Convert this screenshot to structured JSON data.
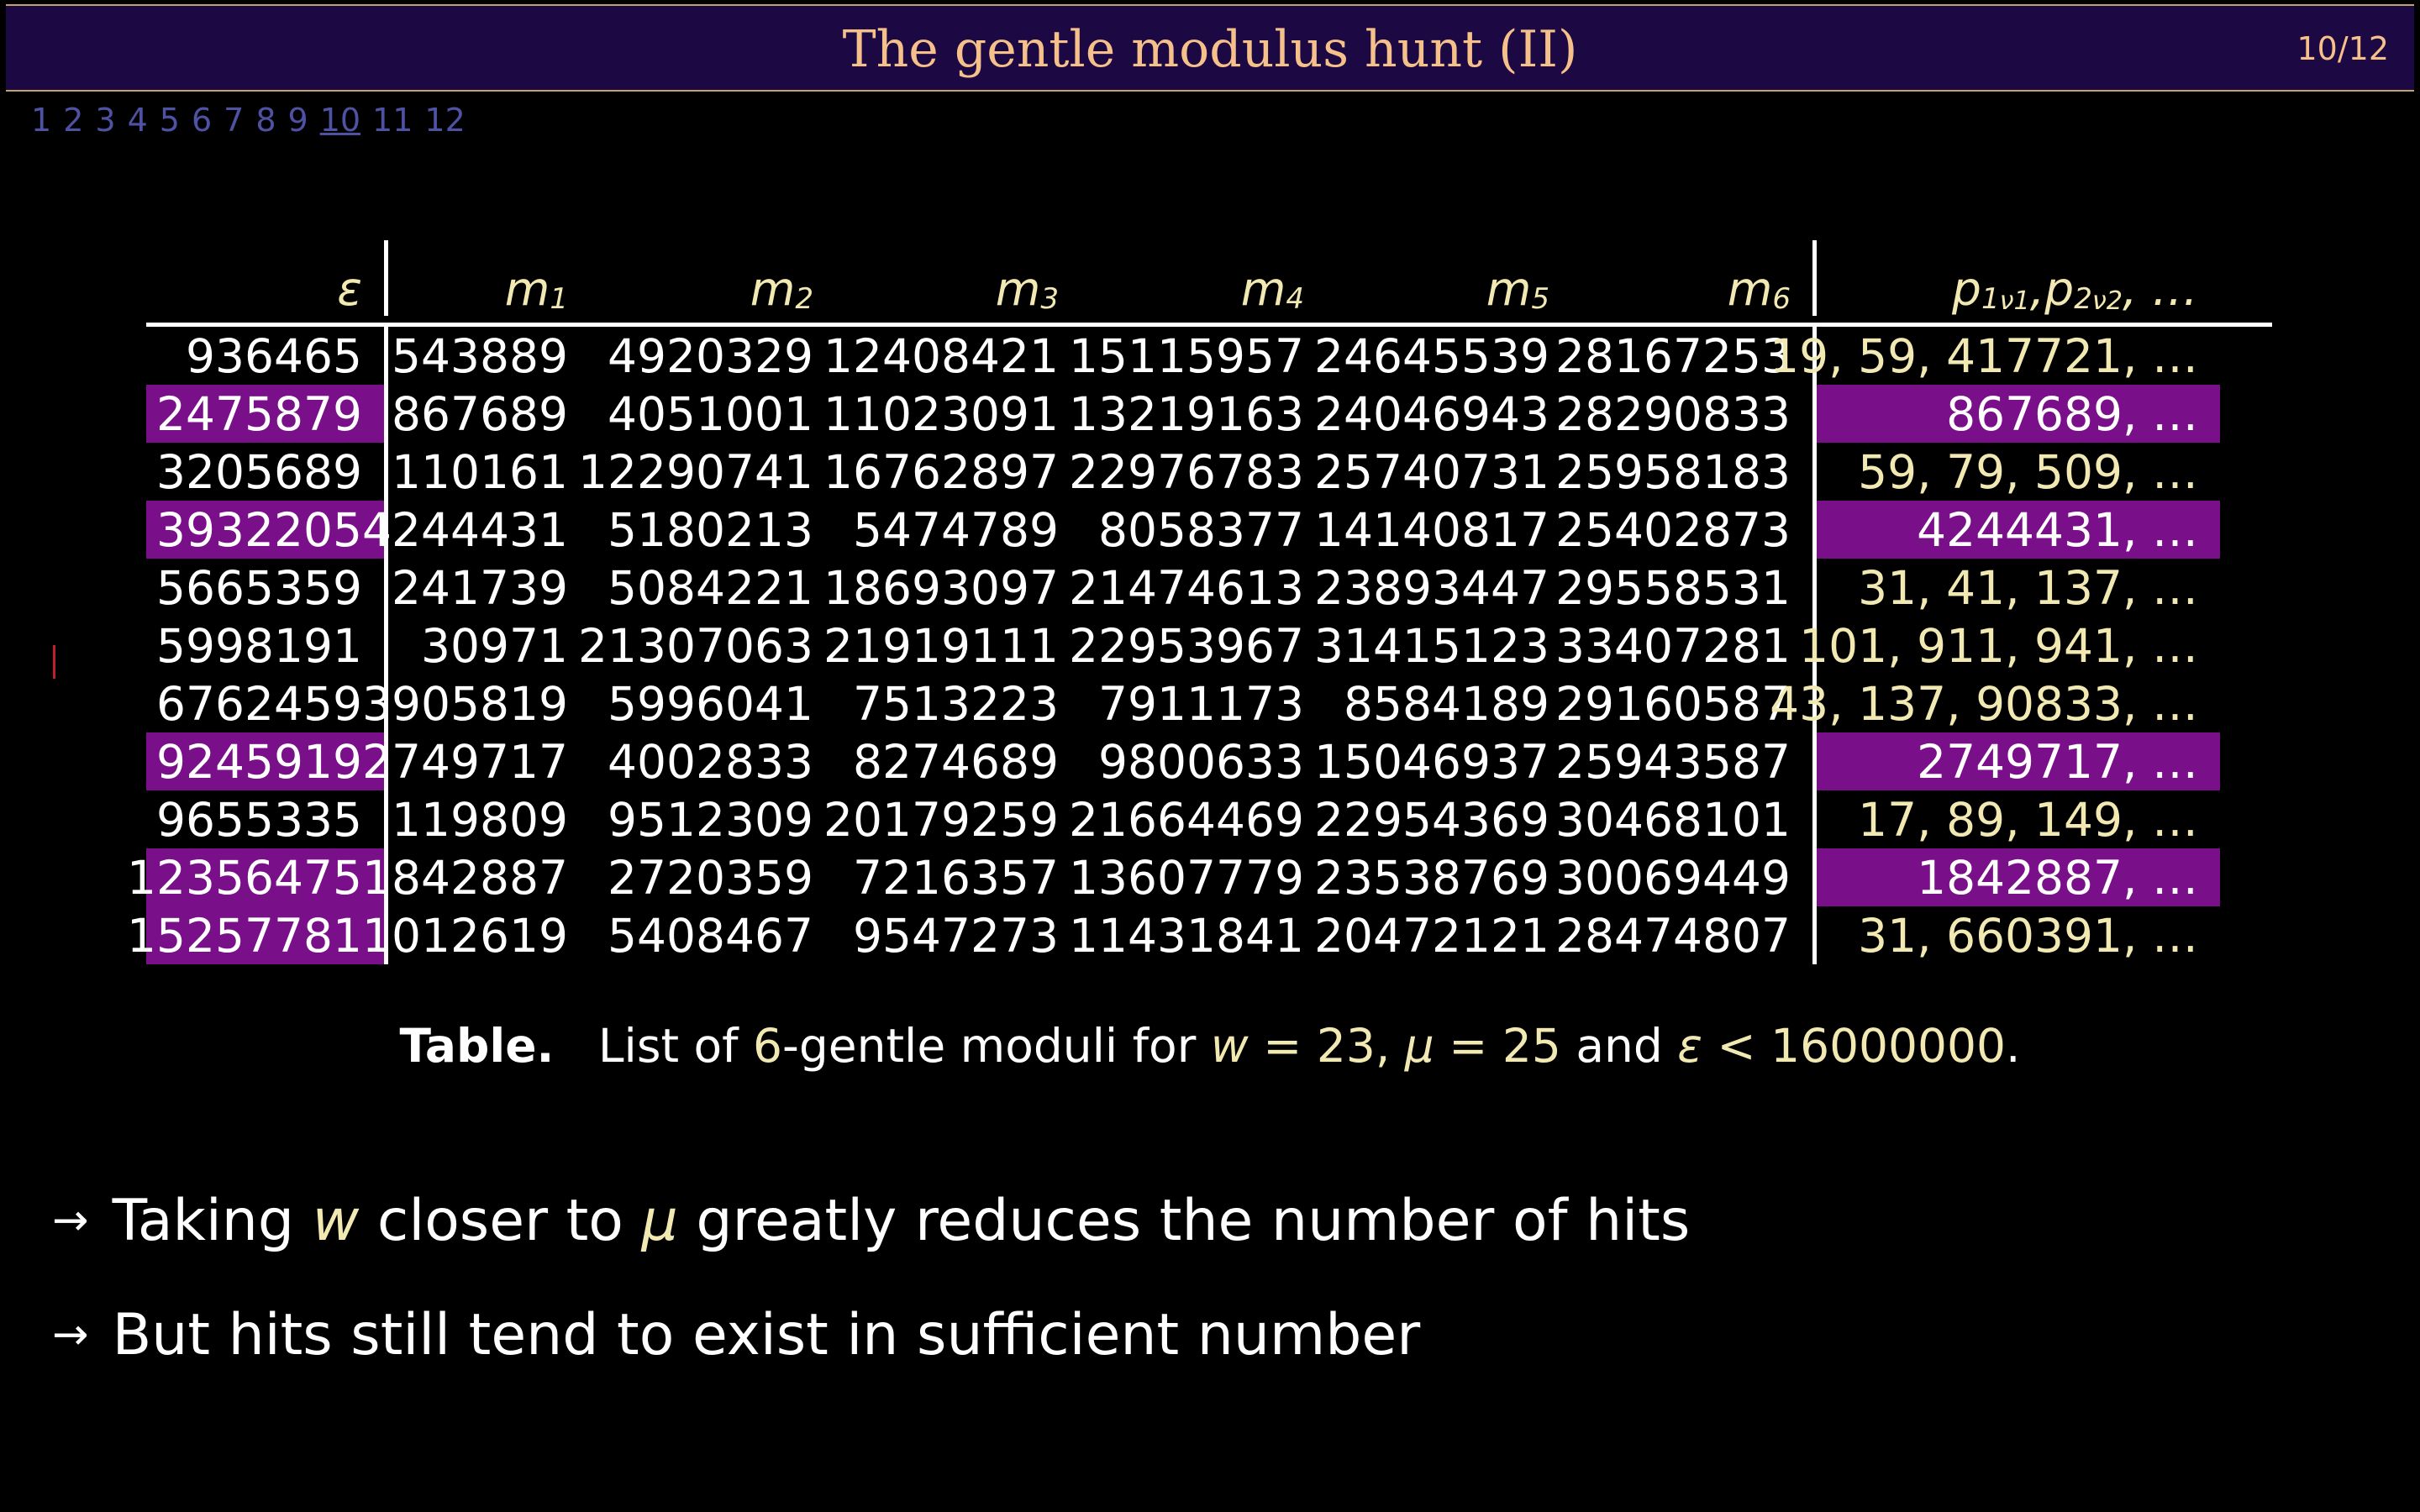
{
  "title": "The gentle modulus hunt (II)",
  "page_counter": "10/12",
  "nav_pages": [
    "1",
    "2",
    "3",
    "4",
    "5",
    "6",
    "7",
    "8",
    "9",
    "10",
    "11",
    "12"
  ],
  "current_page": "10",
  "colors": {
    "title_bar_bg": "#1c0843",
    "title_text": "#f6c08a",
    "highlight": "#7a0f8a",
    "accent_text": "#f2e9b2",
    "nav_text": "#4f52a2"
  },
  "table": {
    "headers": {
      "eps": "ε",
      "m": [
        "m",
        "m",
        "m",
        "m",
        "m",
        "m"
      ],
      "m_sub": [
        "1",
        "2",
        "3",
        "4",
        "5",
        "6"
      ],
      "p_base1": "p",
      "p_sub1": "1",
      "p_sup1": "ν1",
      "p_sep": ", ",
      "p_base2": "p",
      "p_sub2": "2",
      "p_sup2": "ν2",
      "p_tail": ", …"
    },
    "rows": [
      {
        "eps": "936465",
        "m": [
          "543889",
          "4920329",
          "12408421",
          "15115957",
          "24645539",
          "28167253"
        ],
        "p": "19, 59, 417721, …",
        "highlight": false
      },
      {
        "eps": "2475879",
        "m": [
          "867689",
          "4051001",
          "11023091",
          "13219163",
          "24046943",
          "28290833"
        ],
        "p": "867689, …",
        "highlight": true
      },
      {
        "eps": "3205689",
        "m": [
          "110161",
          "12290741",
          "16762897",
          "22976783",
          "25740731",
          "25958183"
        ],
        "p": "59, 79, 509, …",
        "highlight": false
      },
      {
        "eps": "3932205",
        "m": [
          "4244431",
          "5180213",
          "5474789",
          "8058377",
          "14140817",
          "25402873"
        ],
        "p": "4244431, …",
        "highlight": true
      },
      {
        "eps": "5665359",
        "m": [
          "241739",
          "5084221",
          "18693097",
          "21474613",
          "23893447",
          "29558531"
        ],
        "p": "31, 41, 137, …",
        "highlight": false
      },
      {
        "eps": "5998191",
        "m": [
          "30971",
          "21307063",
          "21919111",
          "22953967",
          "31415123",
          "33407281"
        ],
        "p": "101, 911, 941, …",
        "highlight": false
      },
      {
        "eps": "6762459",
        "m": [
          "3905819",
          "5996041",
          "7513223",
          "7911173",
          "8584189",
          "29160587"
        ],
        "p": "43, 137, 90833, …",
        "highlight": false
      },
      {
        "eps": "9245919",
        "m": [
          "2749717",
          "4002833",
          "8274689",
          "9800633",
          "15046937",
          "25943587"
        ],
        "p": "2749717, …",
        "highlight": true
      },
      {
        "eps": "9655335",
        "m": [
          "119809",
          "9512309",
          "20179259",
          "21664469",
          "22954369",
          "30468101"
        ],
        "p": "17, 89, 149, …",
        "highlight": false
      },
      {
        "eps": "12356475",
        "m": [
          "1842887",
          "2720359",
          "7216357",
          "13607779",
          "23538769",
          "30069449"
        ],
        "p": "1842887, …",
        "highlight": true
      },
      {
        "eps": "15257781",
        "m": [
          "1012619",
          "5408467",
          "9547273",
          "11431841",
          "20472121",
          "28474807"
        ],
        "p": "31, 660391, …",
        "highlight": "eps-only"
      }
    ]
  },
  "caption": {
    "label": "Table.",
    "t1": "List of ",
    "n": "6",
    "t2": "-gentle moduli for ",
    "w_var": "w",
    "w_eq": " = 23, ",
    "mu_var": "μ",
    "mu_eq": " = 25",
    "t3": " and ",
    "eps_var": "ε",
    "eps_eq": " < 16000000",
    "end": "."
  },
  "bullets": [
    {
      "arrow": "→",
      "t1": "Taking ",
      "v1": "w",
      "t2": " closer to ",
      "v2": "μ",
      "t3": " greatly reduces the number of hits"
    },
    {
      "arrow": "→",
      "t1": "But hits still tend to exist in sufficient number"
    }
  ]
}
